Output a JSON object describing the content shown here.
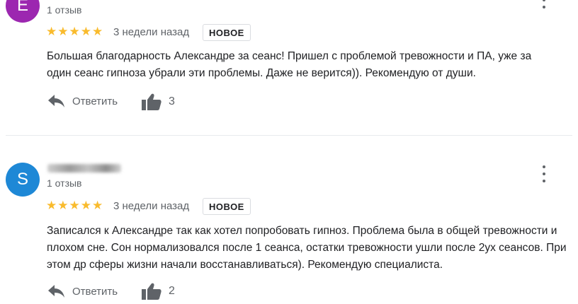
{
  "colors": {
    "avatar_1": "#9c27b0",
    "avatar_2": "#1e88d6",
    "stars": "#f9bb2d",
    "muted": "#5f6368"
  },
  "reviews": [
    {
      "avatar_letter": "E",
      "review_count": "1 отзыв",
      "stars": "★★★★★",
      "rating": 5,
      "time_ago": "3 недели назад",
      "badge": "НОВОЕ",
      "text": "Большая благодарность Александре за сеанс! Пришел с проблемой тревожности и ПА, уже за один сеанс гипноза убрали эти проблемы. Даже не верится)). Рекомендую от души.",
      "reply_label": "Ответить",
      "likes": "3"
    },
    {
      "avatar_letter": "S",
      "review_count": "1 отзыв",
      "stars": "★★★★★",
      "rating": 5,
      "time_ago": "3 недели назад",
      "badge": "НОВОЕ",
      "text": "Записался к Александре так как хотел попробовать гипноз. Проблема была в общей тревожности и плохом сне. Сон нормализовался после 1 сеанса, остатки тревожности ушли после 2ух сеансов. При этом др сферы жизни начали восстанавливаться). Рекомендую специалиста.",
      "reply_label": "Ответить",
      "likes": "2"
    }
  ]
}
